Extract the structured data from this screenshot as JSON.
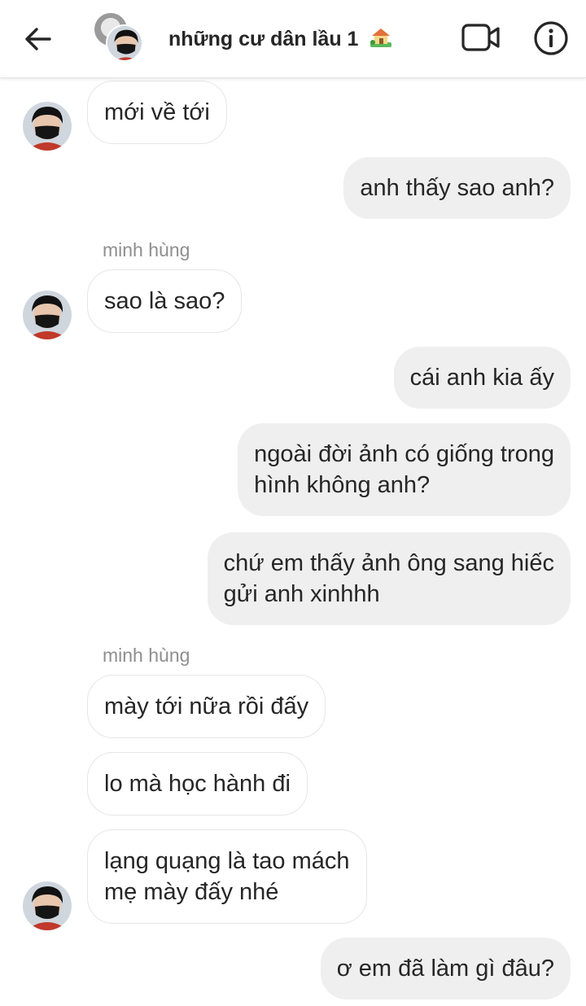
{
  "header": {
    "title": "những cư dân lầu 1",
    "title_emoji_icon": "house-with-garden-icon",
    "back_icon": "arrow-left-icon",
    "video_icon": "video-camera-icon",
    "info_icon": "info-icon"
  },
  "messages": [
    {
      "side": "in",
      "text": "mới về tới"
    },
    {
      "side": "out",
      "text": "anh thấy sao anh?"
    },
    {
      "side": "in",
      "sender": "minh hùng",
      "text": "sao là sao?"
    },
    {
      "side": "out",
      "text": "cái anh kia ấy"
    },
    {
      "side": "out",
      "lines": [
        "ngoài đời ảnh có giống trong",
        "hình không anh?"
      ]
    },
    {
      "side": "out",
      "lines": [
        "chứ em thấy ảnh ông sang hiếc",
        "gửi anh xinhhh"
      ]
    },
    {
      "side": "in",
      "sender": "minh hùng",
      "text": "mày tới nữa rồi đấy"
    },
    {
      "side": "in",
      "text": "lo mà học hành đi"
    },
    {
      "side": "in",
      "lines": [
        "lạng quạng là tao mách",
        "mẹ mày đấy nhé"
      ]
    },
    {
      "side": "out",
      "text": "ơ em đã làm gì đâu?"
    }
  ],
  "colors": {
    "incoming_bubble": "#ffffff",
    "incoming_border": "#e6e6e6",
    "outgoing_bubble": "#efefef",
    "text": "#262626",
    "sender_name": "#8e8e8e"
  }
}
